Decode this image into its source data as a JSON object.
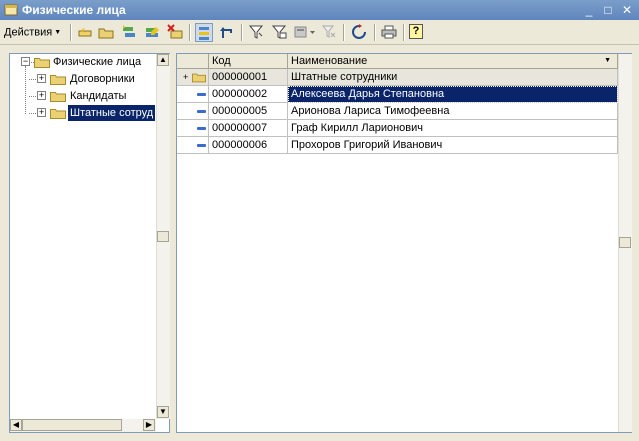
{
  "window": {
    "title": "Физические лица",
    "minimize_glyph": "_",
    "maximize_glyph": "□",
    "close_glyph": "✕"
  },
  "toolbar": {
    "actions_label": "Действия",
    "actions_arrow": "▼",
    "help_label": "?",
    "icons": [
      "add-icon",
      "add-folder-icon",
      "copy-icon",
      "edit-icon",
      "delete-icon",
      "hierarchy-icon",
      "level-up-icon",
      "filter-icon",
      "filter-by-value-icon",
      "filter-history-icon",
      "clear-filter-icon",
      "refresh-icon",
      "print-icon",
      "help-icon"
    ]
  },
  "tree": {
    "root": {
      "label": "Физические лица",
      "expander": "−"
    },
    "children": [
      {
        "label": "Договорники",
        "expander": "+"
      },
      {
        "label": "Кандидаты",
        "expander": "+"
      },
      {
        "label": "Штатные сотруд",
        "expander": "+",
        "selected": true
      }
    ]
  },
  "list": {
    "columns": {
      "code": "Код",
      "name": "Наименование",
      "sort_arrow": "▼"
    },
    "parent_row": {
      "code": "000000001",
      "name": "Штатные сотрудники",
      "marker": "+"
    },
    "rows": [
      {
        "code": "000000002",
        "name": "Алексеева Дарья Степановна",
        "selected": true
      },
      {
        "code": "000000005",
        "name": "Арионова Лариса Тимофеевна"
      },
      {
        "code": "000000007",
        "name": "Граф Кирилл Ларионович"
      },
      {
        "code": "000000006",
        "name": "Прохоров Григорий Иванович"
      }
    ]
  },
  "scroll": {
    "up": "▲",
    "down": "▼",
    "left": "◀",
    "right": "▶"
  },
  "colors": {
    "selection": "#0a246a",
    "titlebar": "#6b8fc3",
    "folder": "#e8d27a"
  }
}
